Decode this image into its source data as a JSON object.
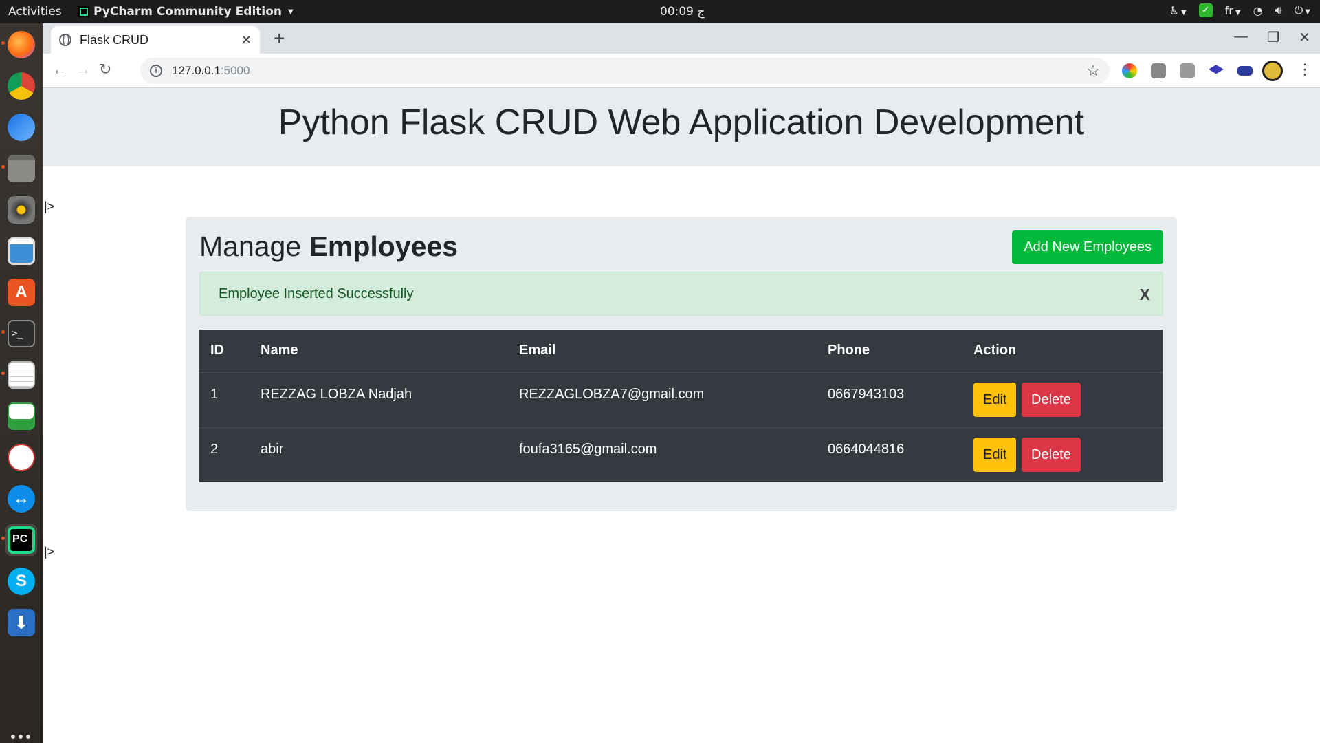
{
  "topbar": {
    "activities": "Activities",
    "app_name": "PyCharm Community Edition",
    "clock": "00:09 ج",
    "keyboard_layout": "fr"
  },
  "dock": {
    "items": [
      "firefox-icon",
      "chrome-icon",
      "thunderbird-icon",
      "files-icon",
      "rhythmbox-icon",
      "image-viewer-icon",
      "software-center-icon",
      "terminal-icon",
      "text-editor-icon",
      "spreadsheet-icon",
      "pdf-editor-icon",
      "teamviewer-icon",
      "pycharm-icon",
      "skype-icon",
      "install-icon"
    ]
  },
  "browser": {
    "tab_title": "Flask CRUD",
    "url_host": "127.0.0.1",
    "url_port": ":5000"
  },
  "page": {
    "heading": "Python Flask CRUD Web Application Development",
    "stray_text": "|>",
    "card": {
      "title_light": "Manage ",
      "title_bold": "Employees",
      "add_button": "Add New Employees",
      "alert_message": "Employee Inserted Successfully",
      "alert_close": "X"
    },
    "table": {
      "headers": [
        "ID",
        "Name",
        "Email",
        "Phone",
        "Action"
      ],
      "rows": [
        {
          "id": "1",
          "name": "REZZAG LOBZA Nadjah",
          "email": "REZZAGLOBZA7@gmail.com",
          "phone": "0667943103",
          "edit": "Edit",
          "delete": "Delete"
        },
        {
          "id": "2",
          "name": "abir",
          "email": "foufa3165@gmail.com",
          "phone": "0664044816",
          "edit": "Edit",
          "delete": "Delete"
        }
      ]
    }
  },
  "colors": {
    "add_button": "#00b93a",
    "edit_button": "#ffc107",
    "delete_button": "#dc3545",
    "table_bg": "#343a40",
    "alert_bg": "#d4edda"
  }
}
